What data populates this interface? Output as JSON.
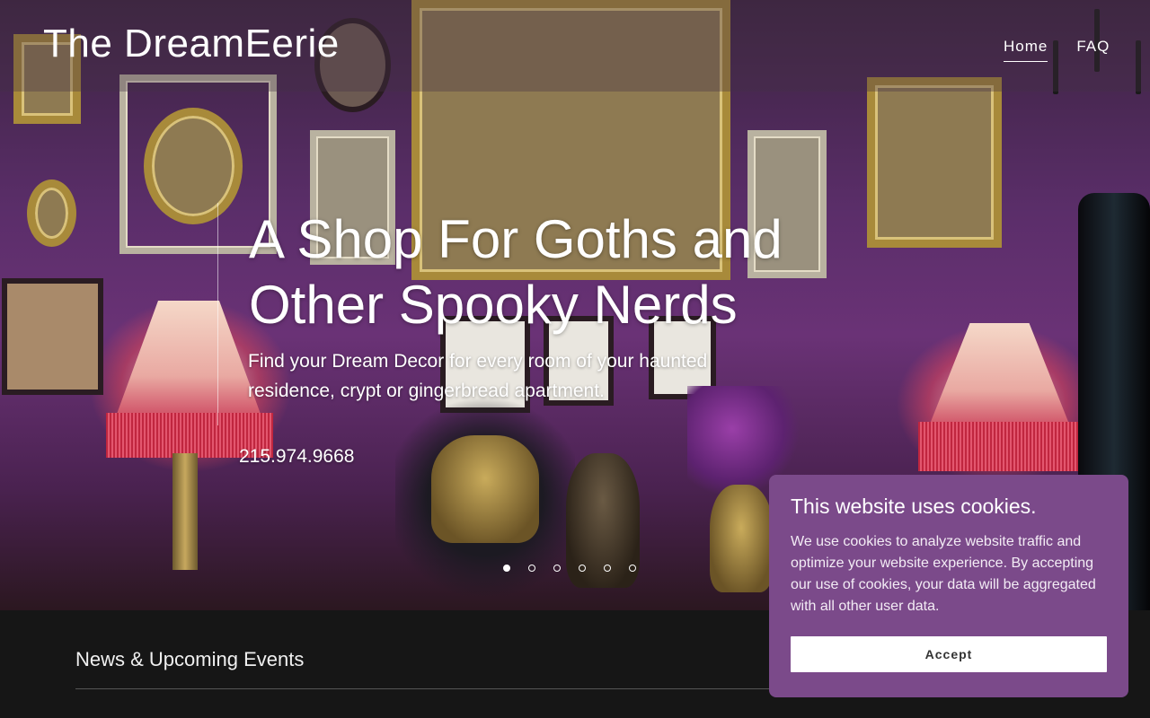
{
  "site": {
    "title": "The DreamEerie"
  },
  "nav": {
    "items": [
      {
        "label": "Home",
        "active": true
      },
      {
        "label": "FAQ",
        "active": false
      }
    ]
  },
  "hero": {
    "headline": "A Shop For Goths and Other Spooky Nerds",
    "subtext": "Find your Dream Decor for every room of your haunted residence, crypt or gingerbread apartment.",
    "phone": "215.974.9668",
    "slides": {
      "count": 6,
      "active_index": 0
    }
  },
  "news": {
    "title": "News & Upcoming Events"
  },
  "cookie_banner": {
    "title": "This website uses cookies.",
    "body": "We use cookies to analyze website traffic and optimize your website experience. By accepting our use of cookies, your data will be aggregated with all other user data.",
    "accept_label": "Accept"
  },
  "colors": {
    "accent": "#7b4a8a",
    "background": "#161616",
    "text": "#ffffff"
  }
}
